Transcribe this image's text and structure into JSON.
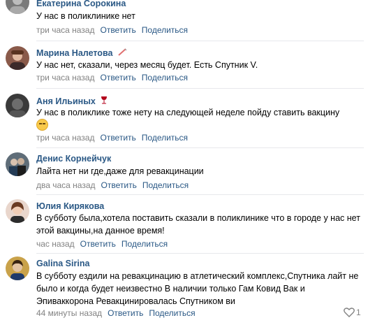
{
  "comments": [
    {
      "author": "Екатерина Сорокина",
      "text": "У нас в поликлинике нет",
      "time": "три часа назад",
      "reply": "Ответить",
      "share": "Поделиться"
    },
    {
      "author": "Марина Налетова",
      "badge_icon": "syringe-icon",
      "text": "У нас нет, сказали, через месяц будет. Есть Спутник V.",
      "time": "три часа назад",
      "reply": "Ответить",
      "share": "Поделиться"
    },
    {
      "author": "Аня Ильиных",
      "badge_icon": "wine-glass-icon",
      "text": "У нас в поликлике тоже нету на следующей неделе пойду ставить вакцину",
      "emoji": "worried-face-emoji",
      "time": "три часа назад",
      "reply": "Ответить",
      "share": "Поделиться"
    },
    {
      "author": "Денис Корнейчук",
      "text": "Лайта нет ни где,даже для ревакцинации",
      "time": "два часа назад",
      "reply": "Ответить",
      "share": "Поделиться"
    },
    {
      "author": "Юлия Кирякова",
      "text": "В субботу была,хотела поставить сказали в поликлинике что в городе у нас нет этой вакцины,на данное время!",
      "time": "час назад",
      "reply": "Ответить",
      "share": "Поделиться"
    },
    {
      "author": "Galina Sirina",
      "text": "В субботу ездили на ревакцинацию в атлетический комплекс,Спутника лайт не было и когда будет неизвестно В наличии только Гам Ковид Вак и Эпиваккорона Ревакцинировалась Спутником ви",
      "time": "44 минуты назад",
      "reply": "Ответить",
      "share": "Поделиться",
      "likes": "1"
    }
  ],
  "colors": {
    "link": "#2a5885",
    "meta": "#828282",
    "separator": "#e7e8ec"
  }
}
